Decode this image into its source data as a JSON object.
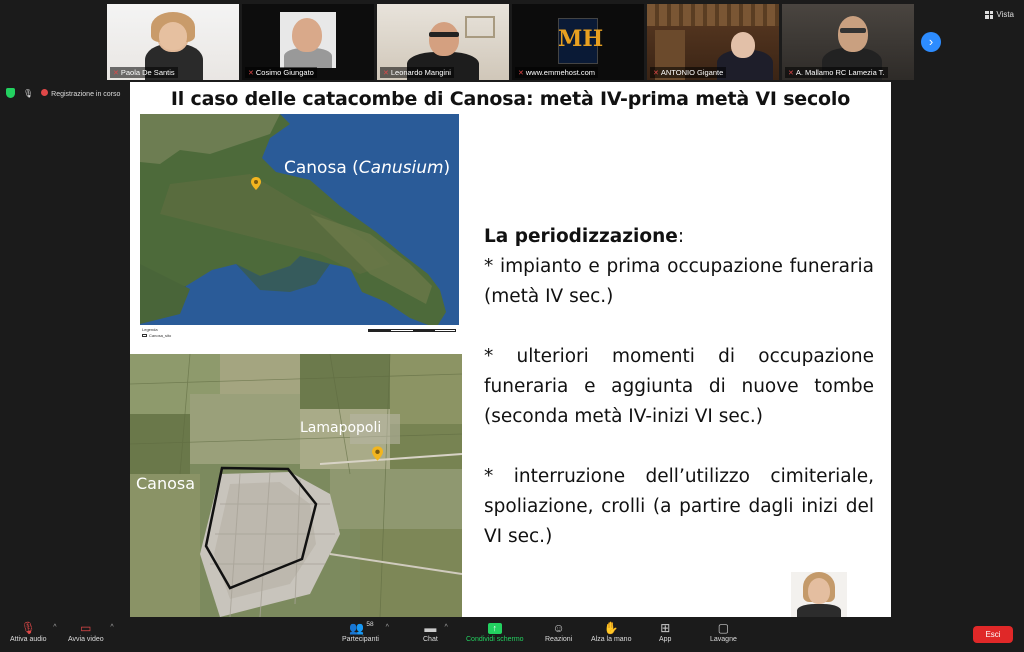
{
  "window": {
    "view_label": "Vista"
  },
  "participants_strip": [
    {
      "name": "Paola De Santis"
    },
    {
      "name": "Cosimo Giungato"
    },
    {
      "name": "Leonardo Mangini"
    },
    {
      "name": "www.emmehost.com"
    },
    {
      "name": "ANTONIO Gigante"
    },
    {
      "name": "A. Mallamo RC Lamezia T."
    }
  ],
  "logo": {
    "text": "MH",
    "caption": "www.emmehost.com"
  },
  "status": {
    "recording_label": "Registrazione in corso"
  },
  "slide": {
    "title": "Il caso delle catacombe di Canosa: metà IV-prima metà VI secolo",
    "map_top": {
      "label_main": "Canosa (",
      "label_italic": "Canusium",
      "label_close": ")",
      "legend": "Legenda",
      "legend_item": "Canosa_sito"
    },
    "map_bottom": {
      "label_lamapopoli": "Lamapopoli",
      "label_canosa": "Canosa"
    },
    "text": {
      "heading_bold": "La periodizzazione",
      "heading_colon": ":",
      "item1": "* impianto e prima occupazione funeraria (metà IV sec.)",
      "item2": "* ulteriori momenti di occupazione funeraria e aggiunta di nuove tombe (seconda metà IV-inizi VI sec.)",
      "item3": "* interruzione dell’utilizzo cimiteriale, spoliazione, crolli (a partire dagli inizi del VI sec.)"
    }
  },
  "toolbar": {
    "audio": "Attiva audio",
    "video": "Avvia video",
    "participants": "Partecipanti",
    "participants_count": "58",
    "chat": "Chat",
    "share": "Condividi schermo",
    "reactions": "Reazioni",
    "raise_hand": "Alza la mano",
    "apps": "App",
    "whiteboards": "Lavagne",
    "exit": "Esci"
  },
  "colors": {
    "share_green": "#23d160",
    "exit_red": "#e02828",
    "next_blue": "#2d8cff"
  }
}
